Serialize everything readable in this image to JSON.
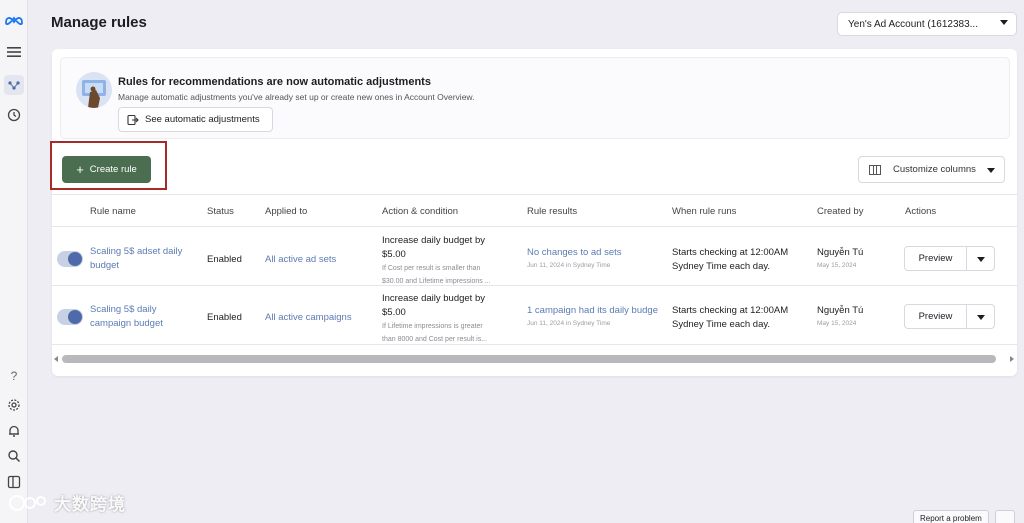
{
  "header": {
    "title": "Manage rules",
    "account": "Yen's Ad Account (1612383..."
  },
  "sidebar": {
    "icons": [
      "meta-logo-icon",
      "menu-icon",
      "rules-icon",
      "history-icon",
      "help-icon",
      "settings-icon",
      "notifications-icon",
      "search-icon",
      "panel-icon"
    ],
    "help_label": "?"
  },
  "banner": {
    "title": "Rules for recommendations are now automatic adjustments",
    "description": "Manage automatic adjustments you've already set up or create new ones in Account Overview.",
    "button_label": "See automatic adjustments"
  },
  "toolbar": {
    "create_label": "Create rule",
    "customize_label": "Customize columns"
  },
  "table": {
    "columns": [
      "Rule name",
      "Status",
      "Applied to",
      "Action & condition",
      "Rule results",
      "When rule runs",
      "Created by",
      "Actions"
    ],
    "rows": [
      {
        "name_line1": "Scaling 5$ adset daily",
        "name_line2": "budget",
        "status": "Enabled",
        "applied_to": "All active ad sets",
        "action_line1": "Increase daily budget by",
        "action_line2": "$5.00",
        "condition_line1": "If Cost per result is smaller than",
        "condition_line2": "$30.00 and Lifetime impressions ...",
        "result": "No changes to ad sets",
        "result_date": "Jun 11, 2024 in Sydney Time",
        "runs_line1": "Starts checking at 12:00AM",
        "runs_line2": "Sydney Time each day.",
        "created_by": "Nguyễn Tú",
        "created_date": "May 15, 2024",
        "action_button": "Preview"
      },
      {
        "name_line1": "Scaling 5$ daily",
        "name_line2": "campaign budget",
        "status": "Enabled",
        "applied_to": "All active campaigns",
        "action_line1": "Increase daily budget by",
        "action_line2": "$5.00",
        "condition_line1": "If Lifetime impressions is greater",
        "condition_line2": "than 8000 and Cost per result is...",
        "result": "1 campaign had its daily budge",
        "result_date": "Jun 11, 2024 in Sydney Time",
        "runs_line1": "Starts checking at 12:00AM",
        "runs_line2": "Sydney Time each day.",
        "created_by": "Nguyễn Tú",
        "created_date": "May 15, 2024",
        "action_button": "Preview"
      }
    ]
  },
  "footer": {
    "report_label": "Report a problem"
  },
  "watermark": {
    "text": "大数跨境"
  },
  "colors": {
    "create_button": "#4a6e4f",
    "highlight": "#a72a2a",
    "link": "#5b7bb3",
    "toggle_knob": "#4e6aa8"
  }
}
